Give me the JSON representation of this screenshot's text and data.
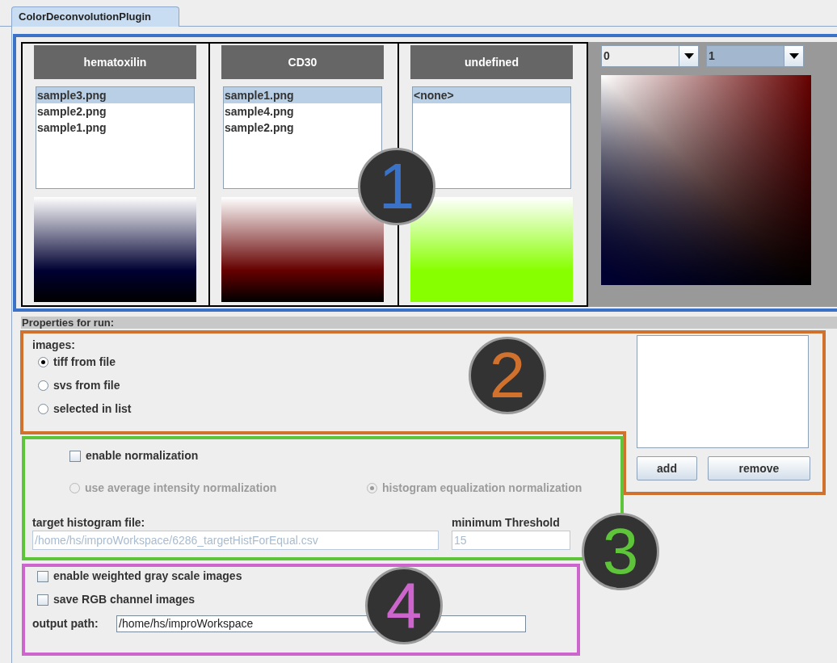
{
  "tab": {
    "label": "ColorDeconvolutionPlugin",
    "selected": true
  },
  "stains": [
    {
      "name": "hematoxilin",
      "color": "#000033",
      "files": [
        {
          "name": "sample3.png",
          "selected": true
        },
        {
          "name": "sample2.png",
          "selected": false
        },
        {
          "name": "sample1.png",
          "selected": false
        }
      ]
    },
    {
      "name": "CD30",
      "color": "#660000",
      "files": [
        {
          "name": "sample1.png",
          "selected": true
        },
        {
          "name": "sample4.png",
          "selected": false
        },
        {
          "name": "sample2.png",
          "selected": false
        }
      ]
    },
    {
      "name": "undefined",
      "color": "#88ff00",
      "files": [
        {
          "name": "<none>",
          "selected": true
        }
      ]
    }
  ],
  "combos": [
    {
      "value": "0",
      "focused": false
    },
    {
      "value": "1",
      "focused": true
    }
  ],
  "properties": {
    "title": "Properties for run:",
    "images_label": "images:",
    "image_sources": [
      {
        "label": "tiff from file",
        "selected": true
      },
      {
        "label": "svs from file",
        "selected": false
      },
      {
        "label": "selected in list",
        "selected": false
      }
    ],
    "buttons": [
      "add",
      "remove"
    ],
    "normalization": {
      "label": "enable normalization",
      "checked": false,
      "methods": [
        {
          "label": "use average intensity normalization",
          "selected": false,
          "disabled": true
        },
        {
          "label": "histogram equalization normalization",
          "selected": true,
          "disabled": true
        }
      ],
      "target_label": "target histogram file:",
      "target_value": "/home/hs/improWorkspace/6286_targetHistForEqual.csv",
      "target_disabled": true,
      "threshold_label": "minimum Threshold",
      "threshold_value": "15",
      "threshold_disabled": true
    },
    "options": [
      {
        "label": "enable weighted gray scale images",
        "checked": false
      },
      {
        "label": "save RGB channel images",
        "checked": false
      }
    ],
    "output_label": "output path:",
    "output_value": "/home/hs/improWorkspace"
  },
  "callouts": [
    {
      "number": "1",
      "color": "#3a72c8"
    },
    {
      "number": "2",
      "color": "#d0722e"
    },
    {
      "number": "3",
      "color": "#5ec43a"
    },
    {
      "number": "4",
      "color": "#cc66cc"
    }
  ]
}
